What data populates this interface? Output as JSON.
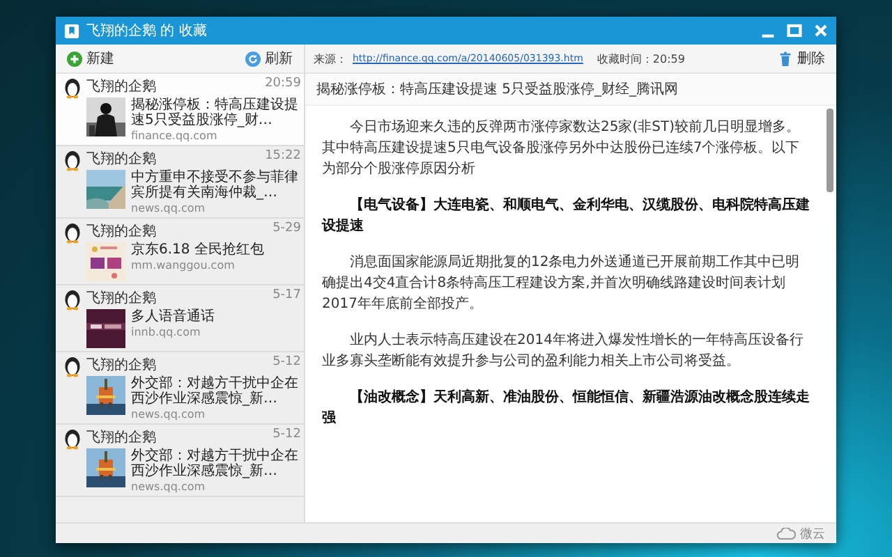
{
  "window": {
    "title": "飞翔的企鹅 的 收藏"
  },
  "toolbar": {
    "new_label": "新建",
    "refresh_label": "刷新"
  },
  "items": [
    {
      "author": "飞翔的企鹅",
      "time": "20:59",
      "headline": "揭秘涨停板：特高压建设提速5只受益股涨停_财…",
      "domain": "finance.qq.com",
      "selected": true
    },
    {
      "author": "飞翔的企鹅",
      "time": "15:22",
      "headline": "中方重申不接受不参与菲律宾所提有关南海仲裁_…",
      "domain": "news.qq.com",
      "selected": false
    },
    {
      "author": "飞翔的企鹅",
      "time": "5-29",
      "headline": "京东6.18 全民抢红包",
      "domain": "mm.wanggou.com",
      "selected": false
    },
    {
      "author": "飞翔的企鹅",
      "time": "5-17",
      "headline": "多人语音通话",
      "domain": "innb.qq.com",
      "selected": false
    },
    {
      "author": "飞翔的企鹅",
      "time": "5-12",
      "headline": "外交部：对越方干扰中企在西沙作业深感震惊_新…",
      "domain": "news.qq.com",
      "selected": false
    },
    {
      "author": "飞翔的企鹅",
      "time": "5-12",
      "headline": "外交部：对越方干扰中企在西沙作业深感震惊_新…",
      "domain": "news.qq.com",
      "selected": false
    }
  ],
  "detail": {
    "source_label": "来源：",
    "source_url": "http://finance.qq.com/a/20140605/031393.htm",
    "saved": "收藏时间：20:59",
    "delete_label": "删除",
    "title": "揭秘涨停板：特高压建设提速 5只受益股涨停_财经_腾讯网",
    "paragraphs": [
      {
        "kind": "text",
        "text": "今日市场迎来久违的反弹两市涨停家数达25家(非ST)较前几日明显增多。其中特高压建设提速5只电气设备股涨停另外中达股份已连续7个涨停板。以下为部分个股涨停原因分析"
      },
      {
        "kind": "heading",
        "text": "【电气设备】大连电瓷、和顺电气、金利华电、汉缆股份、电科院特高压建设提速"
      },
      {
        "kind": "text",
        "text": "消息面国家能源局近期批复的12条电力外送通道已开展前期工作其中已明确提出4交4直合计8条特高压工程建设方案,并首次明确线路建设时间表计划2017年年底前全部投产。"
      },
      {
        "kind": "text",
        "text": "业内人士表示特高压建设在2014年将进入爆发性增长的一年特高压设备行业多寡头垄断能有效提升参与公司的盈利能力相关上市公司将受益。"
      },
      {
        "kind": "heading",
        "text": "【油改概念】天利高新、准油股份、恒能恒信、新疆浩源油改概念股连续走强"
      }
    ]
  },
  "status_bar": {
    "label": "微云"
  }
}
